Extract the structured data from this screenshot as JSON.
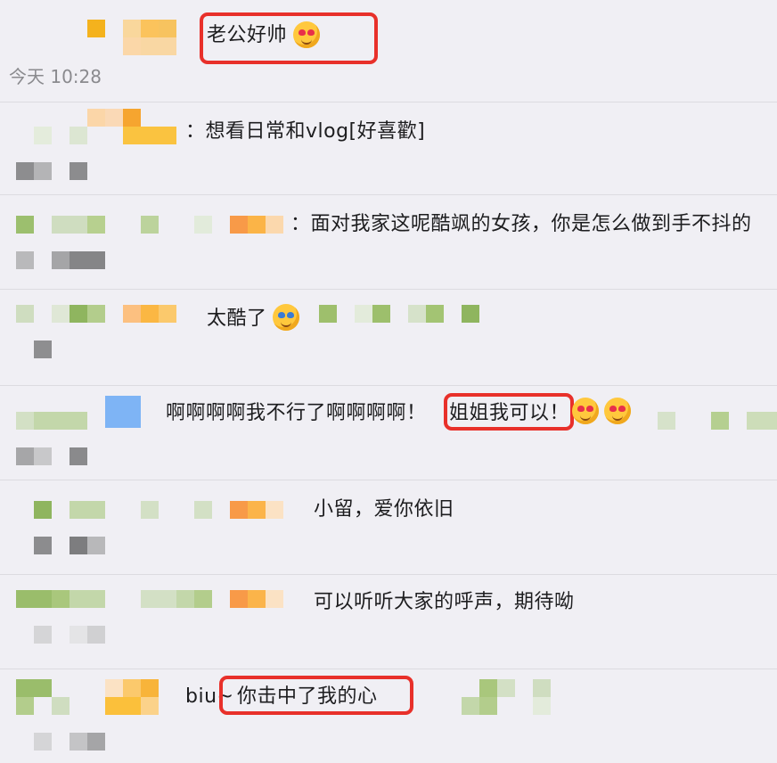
{
  "timestamp": "今天 10:28",
  "comments": [
    {
      "text": "老公好帅",
      "emoji": "kiss-face-emoji"
    },
    {
      "text": "：想看日常和vlog[好喜歡]"
    },
    {
      "text": "：面对我家这呢酷飒的女孩，你是怎么做到手不抖的"
    },
    {
      "text": "太酷了",
      "emoji": "crying-face-emoji"
    },
    {
      "text_a": "啊啊啊啊我不行了啊啊啊啊！",
      "text_b": "姐姐我可以！",
      "emoji": "heart-eyes-emoji"
    },
    {
      "text": "小留，爱你依旧"
    },
    {
      "text": "可以听听大家的呼声，期待呦"
    },
    {
      "text_a": "biu~",
      "text_b": "你击中了我的心"
    }
  ],
  "colors": {
    "highlight": "#e8302a",
    "background": "#f0eff4",
    "separator": "#dcdbe0"
  }
}
